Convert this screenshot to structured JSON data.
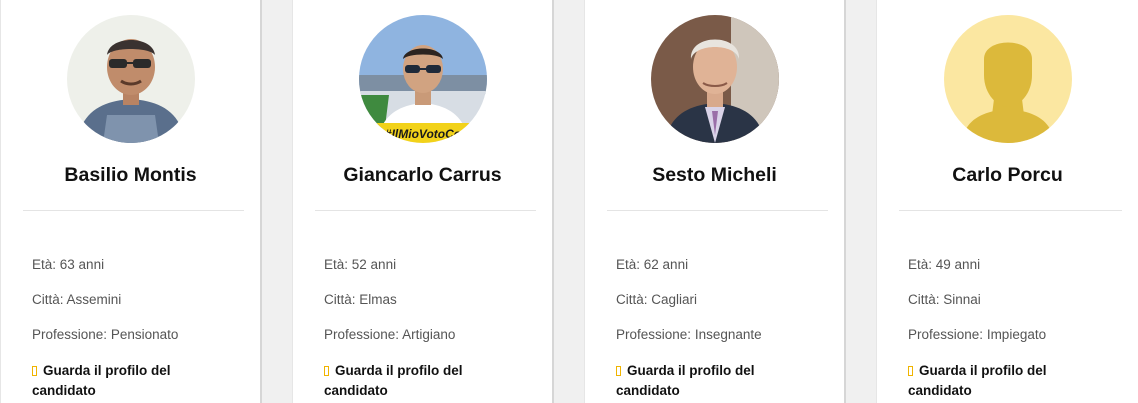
{
  "accent_color": "#f0b400",
  "candidates": [
    {
      "name": "Basilio Montis",
      "age_label": "Età:",
      "age": "63 anni",
      "city_label": "Città:",
      "city": "Assemini",
      "job_label": "Professione:",
      "job": "Pensionato",
      "profile_link": "Guarda il profilo del candidato",
      "avatar_icon": "person-photo-icon"
    },
    {
      "name": "Giancarlo Carrus",
      "age_label": "Età:",
      "age": "52 anni",
      "city_label": "Città:",
      "city": "Elmas",
      "job_label": "Professione:",
      "job": "Artigiano",
      "profile_link": "Guarda il profilo del candidato",
      "avatar_icon": "person-photo-icon",
      "avatar_caption": "#IlMioVotoCo"
    },
    {
      "name": "Sesto Micheli",
      "age_label": "Età:",
      "age": "62 anni",
      "city_label": "Città:",
      "city": "Cagliari",
      "job_label": "Professione:",
      "job": "Insegnante",
      "profile_link": "Guarda il profilo del candidato",
      "avatar_icon": "person-photo-icon"
    },
    {
      "name": "Carlo Porcu",
      "age_label": "Età:",
      "age": "49 anni",
      "city_label": "Città:",
      "city": "Sinnai",
      "job_label": "Professione:",
      "job": "Impiegato",
      "profile_link": "Guarda il profilo del candidato",
      "avatar_icon": "default-avatar-icon"
    }
  ]
}
